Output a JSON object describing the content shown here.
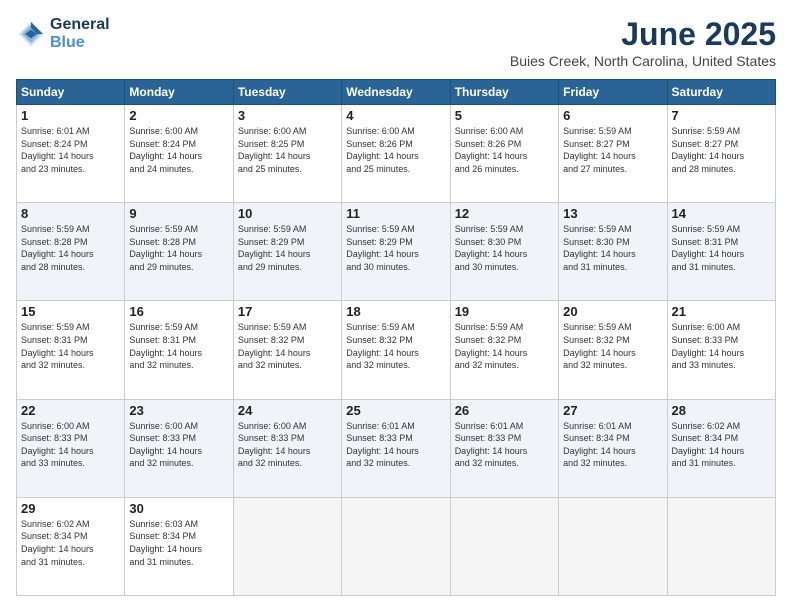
{
  "header": {
    "logo_line1": "General",
    "logo_line2": "Blue",
    "month": "June 2025",
    "location": "Buies Creek, North Carolina, United States"
  },
  "days_of_week": [
    "Sunday",
    "Monday",
    "Tuesday",
    "Wednesday",
    "Thursday",
    "Friday",
    "Saturday"
  ],
  "weeks": [
    [
      {
        "day": "1",
        "info": "Sunrise: 6:01 AM\nSunset: 8:24 PM\nDaylight: 14 hours\nand 23 minutes."
      },
      {
        "day": "2",
        "info": "Sunrise: 6:00 AM\nSunset: 8:24 PM\nDaylight: 14 hours\nand 24 minutes."
      },
      {
        "day": "3",
        "info": "Sunrise: 6:00 AM\nSunset: 8:25 PM\nDaylight: 14 hours\nand 25 minutes."
      },
      {
        "day": "4",
        "info": "Sunrise: 6:00 AM\nSunset: 8:26 PM\nDaylight: 14 hours\nand 25 minutes."
      },
      {
        "day": "5",
        "info": "Sunrise: 6:00 AM\nSunset: 8:26 PM\nDaylight: 14 hours\nand 26 minutes."
      },
      {
        "day": "6",
        "info": "Sunrise: 5:59 AM\nSunset: 8:27 PM\nDaylight: 14 hours\nand 27 minutes."
      },
      {
        "day": "7",
        "info": "Sunrise: 5:59 AM\nSunset: 8:27 PM\nDaylight: 14 hours\nand 28 minutes."
      }
    ],
    [
      {
        "day": "8",
        "info": "Sunrise: 5:59 AM\nSunset: 8:28 PM\nDaylight: 14 hours\nand 28 minutes."
      },
      {
        "day": "9",
        "info": "Sunrise: 5:59 AM\nSunset: 8:28 PM\nDaylight: 14 hours\nand 29 minutes."
      },
      {
        "day": "10",
        "info": "Sunrise: 5:59 AM\nSunset: 8:29 PM\nDaylight: 14 hours\nand 29 minutes."
      },
      {
        "day": "11",
        "info": "Sunrise: 5:59 AM\nSunset: 8:29 PM\nDaylight: 14 hours\nand 30 minutes."
      },
      {
        "day": "12",
        "info": "Sunrise: 5:59 AM\nSunset: 8:30 PM\nDaylight: 14 hours\nand 30 minutes."
      },
      {
        "day": "13",
        "info": "Sunrise: 5:59 AM\nSunset: 8:30 PM\nDaylight: 14 hours\nand 31 minutes."
      },
      {
        "day": "14",
        "info": "Sunrise: 5:59 AM\nSunset: 8:31 PM\nDaylight: 14 hours\nand 31 minutes."
      }
    ],
    [
      {
        "day": "15",
        "info": "Sunrise: 5:59 AM\nSunset: 8:31 PM\nDaylight: 14 hours\nand 32 minutes."
      },
      {
        "day": "16",
        "info": "Sunrise: 5:59 AM\nSunset: 8:31 PM\nDaylight: 14 hours\nand 32 minutes."
      },
      {
        "day": "17",
        "info": "Sunrise: 5:59 AM\nSunset: 8:32 PM\nDaylight: 14 hours\nand 32 minutes."
      },
      {
        "day": "18",
        "info": "Sunrise: 5:59 AM\nSunset: 8:32 PM\nDaylight: 14 hours\nand 32 minutes."
      },
      {
        "day": "19",
        "info": "Sunrise: 5:59 AM\nSunset: 8:32 PM\nDaylight: 14 hours\nand 32 minutes."
      },
      {
        "day": "20",
        "info": "Sunrise: 5:59 AM\nSunset: 8:32 PM\nDaylight: 14 hours\nand 32 minutes."
      },
      {
        "day": "21",
        "info": "Sunrise: 6:00 AM\nSunset: 8:33 PM\nDaylight: 14 hours\nand 33 minutes."
      }
    ],
    [
      {
        "day": "22",
        "info": "Sunrise: 6:00 AM\nSunset: 8:33 PM\nDaylight: 14 hours\nand 33 minutes."
      },
      {
        "day": "23",
        "info": "Sunrise: 6:00 AM\nSunset: 8:33 PM\nDaylight: 14 hours\nand 32 minutes."
      },
      {
        "day": "24",
        "info": "Sunrise: 6:00 AM\nSunset: 8:33 PM\nDaylight: 14 hours\nand 32 minutes."
      },
      {
        "day": "25",
        "info": "Sunrise: 6:01 AM\nSunset: 8:33 PM\nDaylight: 14 hours\nand 32 minutes."
      },
      {
        "day": "26",
        "info": "Sunrise: 6:01 AM\nSunset: 8:33 PM\nDaylight: 14 hours\nand 32 minutes."
      },
      {
        "day": "27",
        "info": "Sunrise: 6:01 AM\nSunset: 8:34 PM\nDaylight: 14 hours\nand 32 minutes."
      },
      {
        "day": "28",
        "info": "Sunrise: 6:02 AM\nSunset: 8:34 PM\nDaylight: 14 hours\nand 31 minutes."
      }
    ],
    [
      {
        "day": "29",
        "info": "Sunrise: 6:02 AM\nSunset: 8:34 PM\nDaylight: 14 hours\nand 31 minutes."
      },
      {
        "day": "30",
        "info": "Sunrise: 6:03 AM\nSunset: 8:34 PM\nDaylight: 14 hours\nand 31 minutes."
      },
      {
        "day": "",
        "info": ""
      },
      {
        "day": "",
        "info": ""
      },
      {
        "day": "",
        "info": ""
      },
      {
        "day": "",
        "info": ""
      },
      {
        "day": "",
        "info": ""
      }
    ]
  ]
}
